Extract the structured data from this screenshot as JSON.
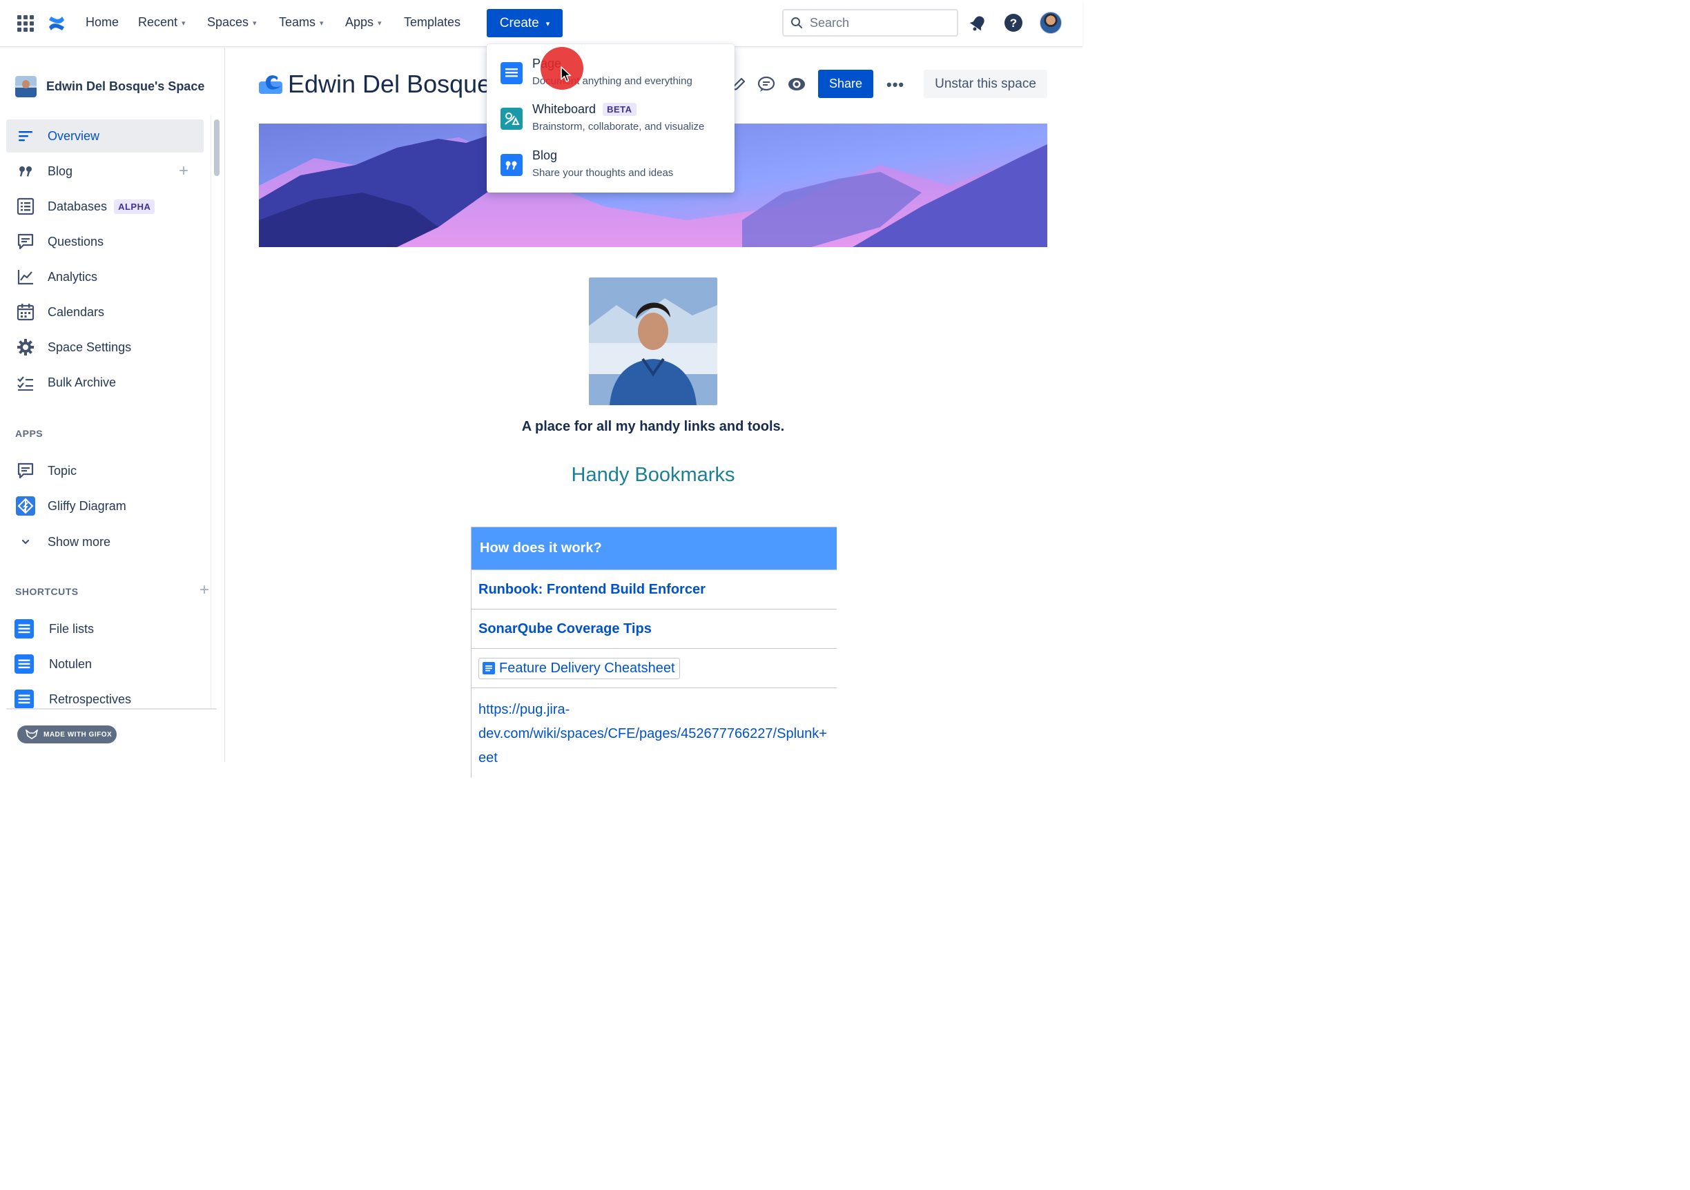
{
  "topnav": {
    "home": "Home",
    "recent": "Recent",
    "spaces": "Spaces",
    "teams": "Teams",
    "apps": "Apps",
    "templates": "Templates",
    "create": "Create",
    "search_placeholder": "Search",
    "icons": [
      "app-switcher-icon",
      "confluence-logo-icon",
      "notifications-icon",
      "help-icon",
      "profile-avatar"
    ]
  },
  "sidebar": {
    "space_name": "Edwin Del Bosque's Space",
    "items": [
      {
        "label": "Overview",
        "icon": "overview-icon"
      },
      {
        "label": "Blog",
        "icon": "quote-icon"
      },
      {
        "label": "Databases",
        "icon": "database-icon",
        "badge": "ALPHA"
      },
      {
        "label": "Questions",
        "icon": "questions-icon"
      },
      {
        "label": "Analytics",
        "icon": "analytics-icon"
      },
      {
        "label": "Calendars",
        "icon": "calendar-icon"
      },
      {
        "label": "Space Settings",
        "icon": "gear-icon"
      },
      {
        "label": "Bulk Archive",
        "icon": "bulk-archive-icon"
      }
    ],
    "apps_label": "APPS",
    "apps": [
      {
        "label": "Topic",
        "icon": "topic-icon"
      },
      {
        "label": "Gliffy Diagram",
        "icon": "gliffy-icon"
      },
      {
        "label": "Show more",
        "icon": "chevron-down-icon"
      }
    ],
    "shortcuts_label": "SHORTCUTS",
    "shortcuts": [
      {
        "label": "File lists"
      },
      {
        "label": "Notulen"
      },
      {
        "label": "Retrospectives"
      }
    ],
    "gifox_label": "MADE WITH GIFOX"
  },
  "main": {
    "title": "Edwin Del Bosque's",
    "share": "Share",
    "unstar": "Unstar this space",
    "tagline": "A place for all my handy links and tools.",
    "heading": "Handy Bookmarks",
    "table": {
      "header": "How does it work?",
      "rows": [
        "Runbook: Frontend Build Enforcer",
        "SonarQube Coverage Tips",
        "Feature Delivery Cheatsheet"
      ],
      "url_lines": [
        "https://pug.jira-",
        "dev.com/wiki/spaces/CFE/pages/452677766227/Splunk+",
        "eet"
      ]
    }
  },
  "create_menu": {
    "items": [
      {
        "title": "Page",
        "desc": "Document anything and everything"
      },
      {
        "title": "Whiteboard",
        "badge": "BETA",
        "desc": "Brainstorm, collaborate, and visualize"
      },
      {
        "title": "Blog",
        "desc": "Share your thoughts and ideas"
      }
    ]
  },
  "colors": {
    "brand_blue": "#0052cc",
    "table_header": "#4c9aff",
    "heading_teal": "#1b7f96",
    "click_indicator": "#e62828"
  }
}
